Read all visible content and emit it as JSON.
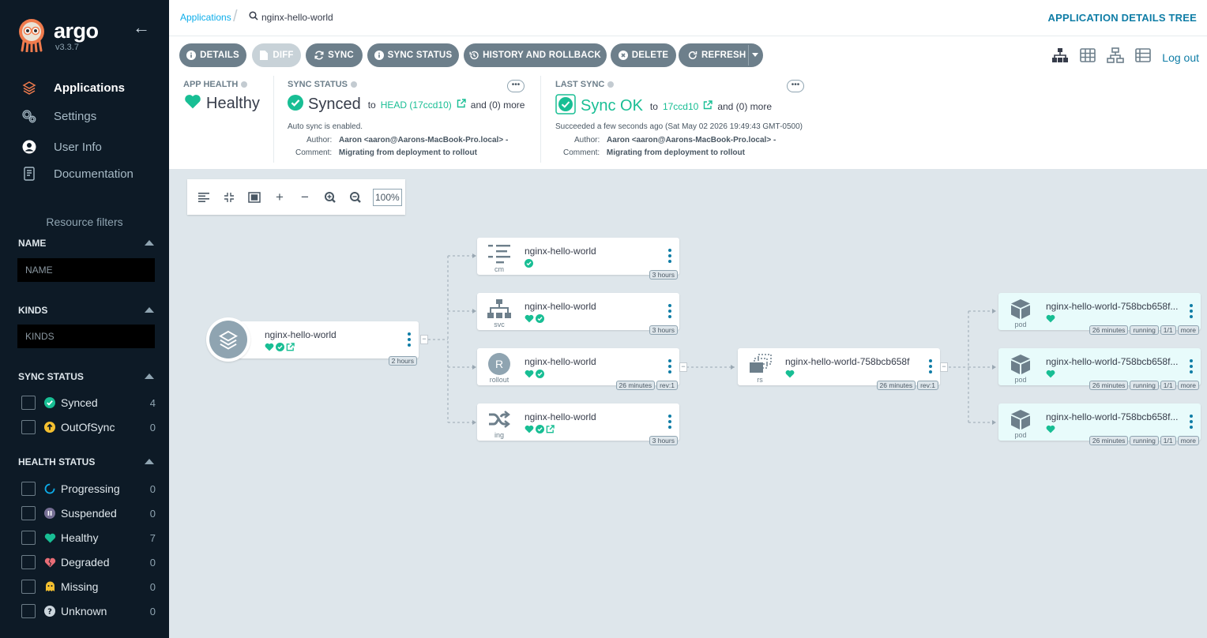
{
  "brand": {
    "name": "argo",
    "version": "v3.3.7"
  },
  "nav": [
    {
      "label": "Applications",
      "icon": "layers-icon",
      "active": true
    },
    {
      "label": "Settings",
      "icon": "gears-icon",
      "active": false
    },
    {
      "label": "User Info",
      "icon": "user-icon",
      "active": false
    },
    {
      "label": "Documentation",
      "icon": "book-icon",
      "active": false
    }
  ],
  "filters": {
    "title": "Resource filters",
    "name": {
      "header": "NAME",
      "placeholder": "NAME"
    },
    "kinds": {
      "header": "KINDS",
      "placeholder": "KINDS"
    },
    "sync_status": {
      "header": "SYNC STATUS",
      "items": [
        {
          "label": "Synced",
          "count": "4",
          "color": "#18be94"
        },
        {
          "label": "OutOfSync",
          "count": "0",
          "color": "#f4c030"
        }
      ]
    },
    "health_status": {
      "header": "HEALTH STATUS",
      "items": [
        {
          "label": "Progressing",
          "count": "0",
          "color": "#0dadea"
        },
        {
          "label": "Suspended",
          "count": "0",
          "color": "#766f94"
        },
        {
          "label": "Healthy",
          "count": "7",
          "color": "#18be94"
        },
        {
          "label": "Degraded",
          "count": "0",
          "color": "#e96d76"
        },
        {
          "label": "Missing",
          "count": "0",
          "color": "#f4c030"
        },
        {
          "label": "Unknown",
          "count": "0",
          "color": "#ccd6dd"
        }
      ]
    }
  },
  "breadcrumb": {
    "link": "Applications",
    "current": "nginx-hello-world"
  },
  "page_title": "APPLICATION DETAILS TREE",
  "toolbar": {
    "details": "DETAILS",
    "diff": "DIFF",
    "sync": "SYNC",
    "sync_status": "SYNC STATUS",
    "history": "HISTORY AND ROLLBACK",
    "delete": "DELETE",
    "refresh": "REFRESH",
    "logout": "Log out"
  },
  "status": {
    "app_health": {
      "label": "APP HEALTH",
      "value": "Healthy"
    },
    "sync_status": {
      "label": "SYNC STATUS",
      "value": "Synced",
      "to": "to",
      "revision": "HEAD (17ccd10)",
      "more": "and (0) more",
      "auto": "Auto sync is enabled.",
      "author_label": "Author:",
      "author": "Aaron <aaron@Aarons-MacBook-Pro.local> -",
      "comment_label": "Comment:",
      "comment": "Migrating from deployment to rollout"
    },
    "last_sync": {
      "label": "LAST SYNC",
      "value": "Sync OK",
      "to": "to",
      "revision": "17ccd10",
      "more": "and (0) more",
      "succeeded": "Succeeded a few seconds ago (Sat May 02 2026 19:49:43 GMT-0500)",
      "author_label": "Author:",
      "author": "Aaron <aaron@Aarons-MacBook-Pro.local> -",
      "comment_label": "Comment:",
      "comment": "Migrating from deployment to rollout"
    },
    "more_btn": "•••"
  },
  "zoom": {
    "level": "100%"
  },
  "nodes": {
    "app": {
      "name": "nginx-hello-world",
      "tags": [
        "2 hours"
      ]
    },
    "cm": {
      "name": "nginx-hello-world",
      "kind": "cm",
      "tags": [
        "3 hours"
      ]
    },
    "svc": {
      "name": "nginx-hello-world",
      "kind": "svc",
      "tags": [
        "3 hours"
      ]
    },
    "rollout": {
      "name": "nginx-hello-world",
      "kind": "rollout",
      "letter": "R",
      "tags": [
        "26 minutes",
        "rev:1"
      ]
    },
    "ing": {
      "name": "nginx-hello-world",
      "kind": "ing",
      "tags": [
        "3 hours"
      ]
    },
    "rs": {
      "name": "nginx-hello-world-758bcb658f",
      "kind": "rs",
      "tags": [
        "26 minutes",
        "rev:1"
      ]
    },
    "pods": [
      {
        "name": "nginx-hello-world-758bcb658f...",
        "kind": "pod",
        "tags": [
          "26 minutes",
          "running",
          "1/1",
          "more"
        ]
      },
      {
        "name": "nginx-hello-world-758bcb658f...",
        "kind": "pod",
        "tags": [
          "26 minutes",
          "running",
          "1/1",
          "more"
        ]
      },
      {
        "name": "nginx-hello-world-758bcb658f...",
        "kind": "pod",
        "tags": [
          "26 minutes",
          "running",
          "1/1",
          "more"
        ]
      }
    ]
  },
  "colors": {
    "healthy": "#18be94",
    "sidebar": "#0d1a26",
    "link": "#0dadea",
    "canvas": "#dee6eb"
  }
}
